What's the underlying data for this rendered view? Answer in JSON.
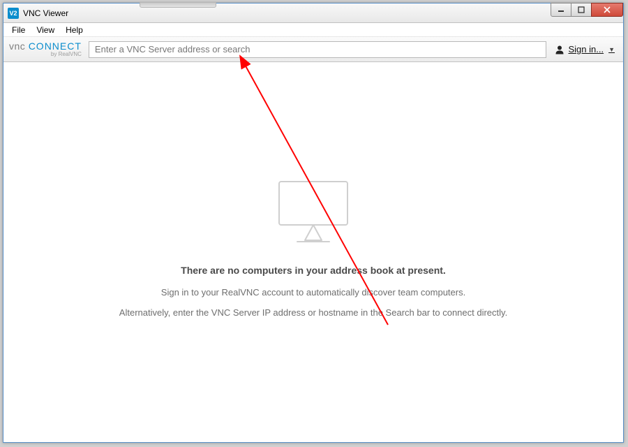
{
  "titlebar": {
    "icon_text": "V2",
    "title": "VNC Viewer"
  },
  "menubar": {
    "items": [
      "File",
      "View",
      "Help"
    ]
  },
  "toolbar": {
    "logo_vnc": "vnc",
    "logo_connect": "CONNECT",
    "logo_sub": "by RealVNC",
    "address_placeholder": "Enter a VNC Server address or search",
    "signin_label": "Sign in..."
  },
  "empty_state": {
    "title": "There are no computers in your address book at present.",
    "line1": "Sign in to your RealVNC account to automatically discover team computers.",
    "line2": "Alternatively, enter the VNC Server IP address or hostname in the Search bar to connect directly."
  }
}
